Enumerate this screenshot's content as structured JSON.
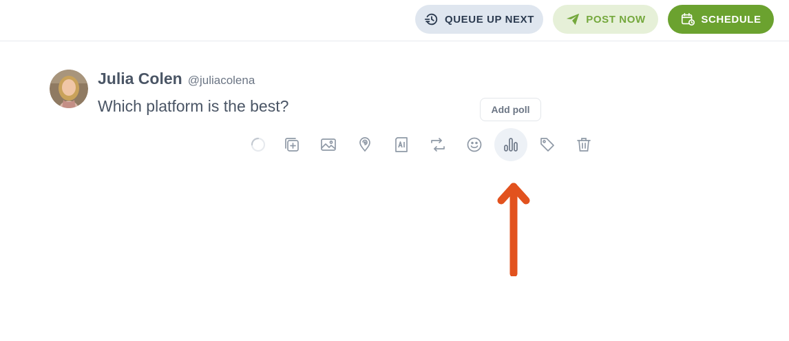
{
  "actions": {
    "queue_label": "QUEUE UP NEXT",
    "post_now_label": "POST NOW",
    "schedule_label": "SCHEDULE"
  },
  "post": {
    "author_name": "Julia Colen",
    "author_handle": "@juliacolena",
    "text": "Which platform is the best?"
  },
  "toolbar": {
    "tooltip": "Add poll",
    "active_tool": "poll",
    "tools": [
      "loading-spinner-icon",
      "add-thread-icon",
      "image-icon",
      "location-icon",
      "ai-icon",
      "retweet-icon",
      "emoji-icon",
      "poll-icon",
      "tag-icon",
      "trash-icon"
    ]
  },
  "colors": {
    "brand_green": "#6ba22f",
    "post_now_text": "#74a83c",
    "arrow": "#e2521e",
    "icon": "#8f99a6"
  }
}
